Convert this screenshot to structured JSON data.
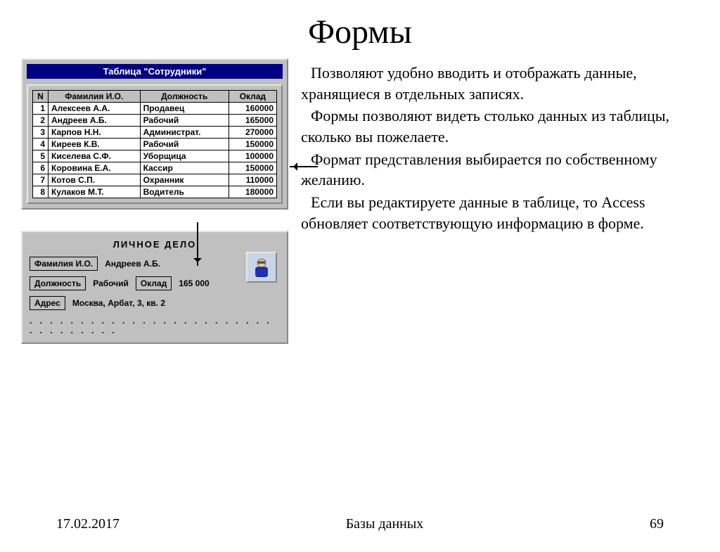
{
  "title": "Формы",
  "table_window": {
    "title": "Таблица  \"Сотрудники\"",
    "columns": [
      "N",
      "Фамилия И.О.",
      "Должность",
      "Оклад"
    ],
    "rows": [
      {
        "n": "1",
        "name": "Алексеев А.А.",
        "pos": "Продавец",
        "sal": "160000"
      },
      {
        "n": "2",
        "name": "Андреев А.Б.",
        "pos": "Рабочий",
        "sal": "165000"
      },
      {
        "n": "3",
        "name": "Карпов Н.Н.",
        "pos": "Администрат.",
        "sal": "270000"
      },
      {
        "n": "4",
        "name": "Киреев К.В.",
        "pos": "Рабочий",
        "sal": "150000"
      },
      {
        "n": "5",
        "name": "Киселева С.Ф.",
        "pos": "Уборщица",
        "sal": "100000"
      },
      {
        "n": "6",
        "name": "Коровина Е.А.",
        "pos": "Кассир",
        "sal": "150000"
      },
      {
        "n": "7",
        "name": "Котов С.П.",
        "pos": "Охранник",
        "sal": "110000"
      },
      {
        "n": "8",
        "name": "Кулаков М.Т.",
        "pos": "Водитель",
        "sal": "180000"
      }
    ]
  },
  "form_window": {
    "title": "ЛИЧНОЕ  ДЕЛО",
    "name_label": "Фамилия И.О.",
    "name_value": "Андреев А.Б.",
    "pos_label": "Должность",
    "pos_value": "Рабочий",
    "sal_label": "Оклад",
    "sal_value": "165 000",
    "addr_label": "Адрес",
    "addr_value": "Москва, Арбат, 3, кв. 2",
    "dots": ". . . . . . . . . . . . . . . . . . . . . . . . . . . . . . . . ."
  },
  "body_text": {
    "p1": "Позволяют удобно вводить и отображать данные, хранящиеся в отдельных записях.",
    "p2": "Формы позволяют видеть столько данных из таблицы, сколько вы пожелаете.",
    "p3": "Формат представления выбирается по собственному желанию.",
    "p4": "Если вы редактируете данные в таблице, то Access обновляет соответствующую информацию в форме."
  },
  "footer": {
    "date": "17.02.2017",
    "center": "Базы данных",
    "page": "69"
  }
}
